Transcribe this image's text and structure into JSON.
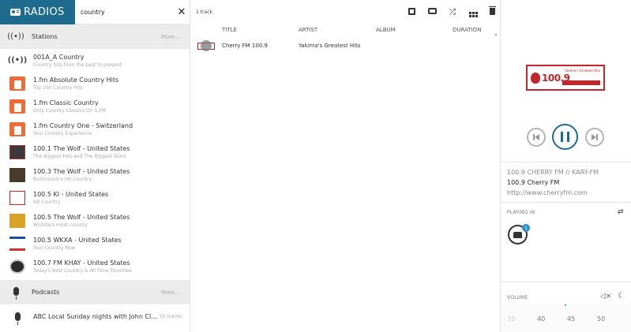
{
  "brand": {
    "title": "RADIOS"
  },
  "search": {
    "value": "country",
    "clear": "✕"
  },
  "stations_section": {
    "title": "Stations",
    "more": "More...",
    "icon": "broadcast-icon"
  },
  "stations": [
    {
      "name": "001A_A Country",
      "desc": "Country hits from the past to present",
      "logo": "broadcast"
    },
    {
      "name": "1.fm Absolute Country Hits",
      "desc": "Top 100 Country Hits",
      "logo": "fm"
    },
    {
      "name": "1.fm Classic Country",
      "desc": "Only Country Classics On 1.FM",
      "logo": "fm"
    },
    {
      "name": "1.fm Country One - Switzerland",
      "desc": "Your Country Experience",
      "logo": "fm"
    },
    {
      "name": "100.1 The Wolf - United States",
      "desc": "The Biggest Hits and The Biggest Stars",
      "logo": "dark"
    },
    {
      "name": "100.3 The Wolf - United States",
      "desc": "Richmonds's Hit Country",
      "logo": "dark2"
    },
    {
      "name": "100.5 KI - United States",
      "desc": "Hit Country",
      "logo": "ki"
    },
    {
      "name": "100.5 The Wolf - United States",
      "desc": "Wichita's most country",
      "logo": "wolf"
    },
    {
      "name": "100.5 WKXA - United States",
      "desc": "Your Country Now",
      "logo": "wkxa"
    },
    {
      "name": "100.7 FM KHAY - United States",
      "desc": "Today's Best Country & All Time Favorites",
      "logo": "khay"
    }
  ],
  "podcasts_section": {
    "title": "Podcasts",
    "more": "More...",
    "icon": "microphone-icon"
  },
  "podcasts": [
    {
      "name": "ABC Local Sunday nights with John Cle...",
      "count": "50 tracks"
    }
  ],
  "toolbar": {
    "count": "1 track"
  },
  "track_table": {
    "columns": {
      "title": "TITLE",
      "artist": "ARTIST",
      "album": "ALBUM",
      "duration": "DURATION"
    },
    "rows": [
      {
        "title": "Cherry FM 100.9",
        "artist": "Yakima's Greatest Hits",
        "album": "",
        "duration": ""
      }
    ]
  },
  "player": {
    "logo_text": "100.9",
    "logo_tag": "Yakima's Greatest Hits",
    "station_line": "100.9 CHERRY FM // KARY-FM",
    "title_line": "100.9 Cherry FM",
    "url_line": "http://www.cherryfm.com",
    "playing_in_label": "PLAYING IN",
    "device_count": "1",
    "volume_label": "VOLUME",
    "volume_ticks": [
      "35",
      "40",
      "45",
      "50"
    ],
    "swap_glyph": "⇄",
    "mute_glyph": "🔇",
    "moon_glyph": "☾"
  },
  "colors": {
    "brand": "#1d6b8f",
    "accent": "#2a8fd0",
    "station_red": "#c0272d"
  }
}
